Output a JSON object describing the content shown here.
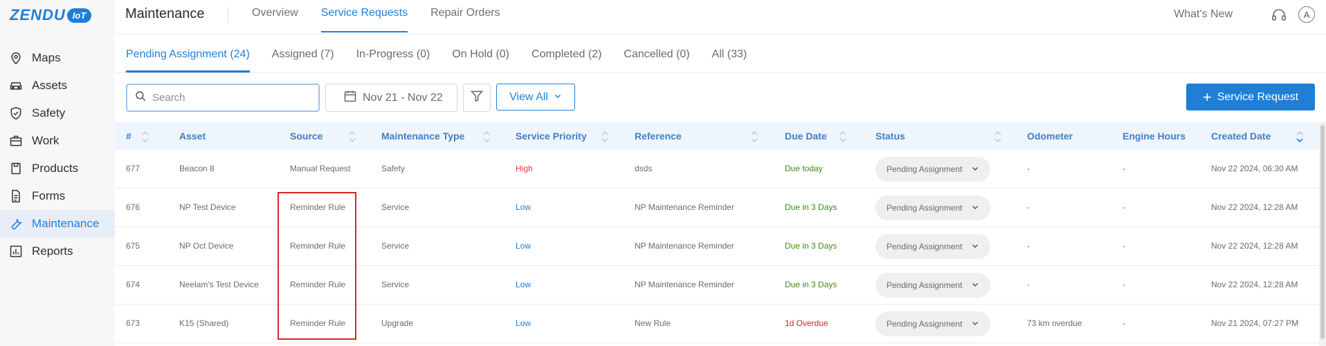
{
  "brand": {
    "name": "ZENDU",
    "badge": "IoT",
    "color": "#1f7fd6"
  },
  "sidebar": {
    "items": [
      {
        "label": "Maps",
        "icon": "map-pin-icon"
      },
      {
        "label": "Assets",
        "icon": "car-icon"
      },
      {
        "label": "Safety",
        "icon": "shield-check-icon"
      },
      {
        "label": "Work",
        "icon": "briefcase-icon"
      },
      {
        "label": "Products",
        "icon": "clipboard-icon"
      },
      {
        "label": "Forms",
        "icon": "document-icon"
      },
      {
        "label": "Maintenance",
        "icon": "wrench-icon",
        "active": true
      },
      {
        "label": "Reports",
        "icon": "bar-chart-icon"
      }
    ]
  },
  "header": {
    "title": "Maintenance",
    "tabs": [
      {
        "label": "Overview"
      },
      {
        "label": "Service Requests",
        "active": true
      },
      {
        "label": "Repair Orders"
      }
    ],
    "whats_new": "What's New",
    "avatar_initial": "A"
  },
  "status_tabs": [
    {
      "label": "Pending Assignment (24)",
      "active": true
    },
    {
      "label": "Assigned (7)"
    },
    {
      "label": "In-Progress (0)"
    },
    {
      "label": "On Hold (0)"
    },
    {
      "label": "Completed (2)"
    },
    {
      "label": "Cancelled (0)"
    },
    {
      "label": "All (33)"
    }
  ],
  "toolbar": {
    "search_placeholder": "Search",
    "date_range": "Nov 21 - Nov 22",
    "view_all": "View All",
    "add_label": "Service Request"
  },
  "table": {
    "columns": [
      "#",
      "Asset",
      "Source",
      "Maintenance Type",
      "Service Priority",
      "Reference",
      "Due Date",
      "Status",
      "Odometer",
      "Engine Hours",
      "Created Date"
    ],
    "rows": [
      {
        "id": "677",
        "asset": "Beacon 8",
        "source": "Manual Request",
        "type": "Safety",
        "priority": "High",
        "reference": "dsds",
        "due": "Due today",
        "status": "Pending Assignment",
        "odometer": "-",
        "engine": "-",
        "created": "Nov 22 2024, 06:30 AM"
      },
      {
        "id": "676",
        "asset": "NP Test Device",
        "source": "Reminder Rule",
        "type": "Service",
        "priority": "Low",
        "reference": "NP Maintenance Reminder",
        "due": "Due in 3 Days",
        "status": "Pending Assignment",
        "odometer": "-",
        "engine": "-",
        "created": "Nov 22 2024, 12:28 AM"
      },
      {
        "id": "675",
        "asset": "NP Oct Device",
        "source": "Reminder Rule",
        "type": "Service",
        "priority": "Low",
        "reference": "NP Maintenance Reminder",
        "due": "Due in 3 Days",
        "status": "Pending Assignment",
        "odometer": "-",
        "engine": "-",
        "created": "Nov 22 2024, 12:28 AM"
      },
      {
        "id": "674",
        "asset": "Neelam's Test Device",
        "source": "Reminder Rule",
        "type": "Service",
        "priority": "Low",
        "reference": "NP Maintenance Reminder",
        "due": "Due in 3 Days",
        "status": "Pending Assignment",
        "odometer": "-",
        "engine": "-",
        "created": "Nov 22 2024, 12:28 AM"
      },
      {
        "id": "673",
        "asset": "K15 (Shared)",
        "source": "Reminder Rule",
        "type": "Upgrade",
        "priority": "Low",
        "reference": "New Rule",
        "due": "1d Overdue",
        "status": "Pending Assignment",
        "odometer": "73 km overdue",
        "engine": "-",
        "created": "Nov 21 2024, 07:27 PM"
      }
    ]
  },
  "colors": {
    "accent": "#1f7fd6",
    "high": "#e03b3b",
    "due_ok": "#3a8a1a",
    "overdue": "#c62828",
    "highlight": "#e02020"
  }
}
